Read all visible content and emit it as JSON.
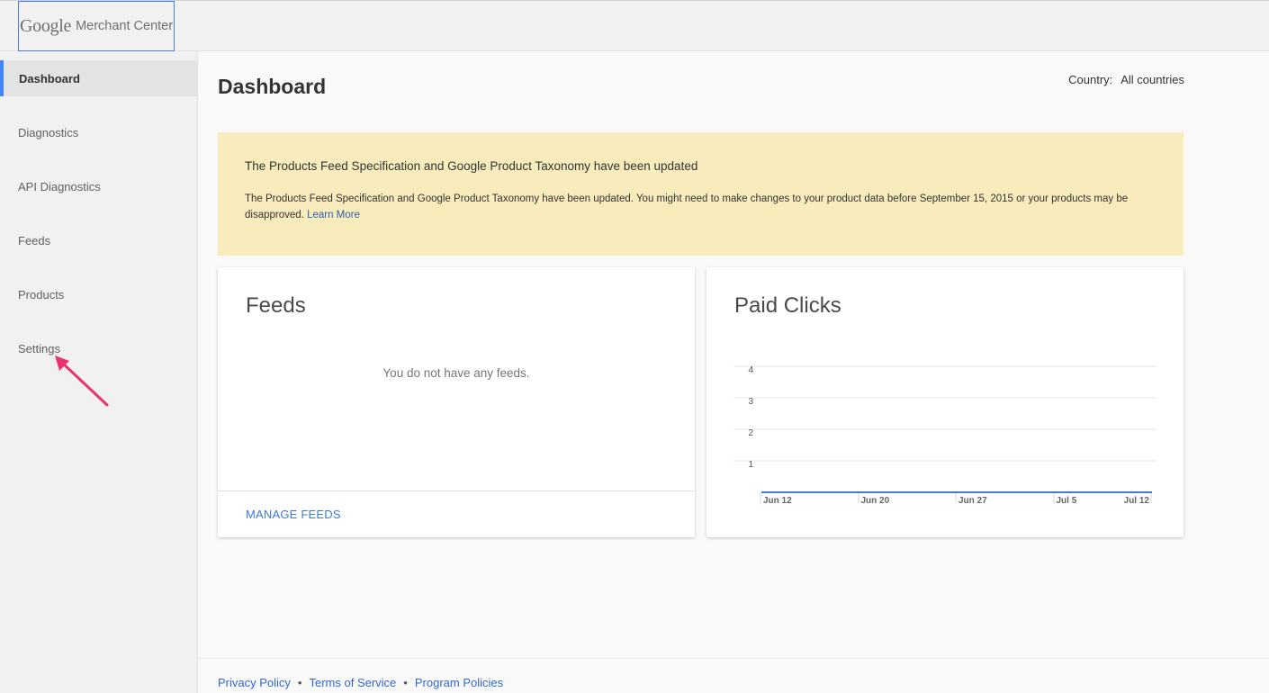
{
  "header": {
    "logo_google": "Google",
    "logo_product": "Merchant Center"
  },
  "sidebar": {
    "items": [
      {
        "label": "Dashboard",
        "active": true
      },
      {
        "label": "Diagnostics"
      },
      {
        "label": "API Diagnostics"
      },
      {
        "label": "Feeds"
      },
      {
        "label": "Products"
      },
      {
        "label": "Settings"
      }
    ]
  },
  "main": {
    "title": "Dashboard",
    "country_label": "Country:",
    "country_value": "All countries",
    "banner": {
      "title": "The Products Feed Specification and Google Product Taxonomy have been updated",
      "body": "The Products Feed Specification and Google Product Taxonomy have been updated. You might need to make changes to your product data before September 15, 2015 or your products may be disapproved.",
      "link": "Learn More"
    },
    "feeds_card": {
      "title": "Feeds",
      "empty_text": "You do not have any feeds.",
      "action": "MANAGE FEEDS"
    },
    "clicks_card": {
      "title": "Paid Clicks"
    }
  },
  "chart_data": {
    "type": "line",
    "title": "Paid Clicks",
    "x": [
      "Jun 12",
      "Jun 20",
      "Jun 27",
      "Jul 5",
      "Jul 12"
    ],
    "y_ticks": [
      1,
      2,
      3,
      4
    ],
    "ylim": [
      0,
      4
    ],
    "series": [
      {
        "values": [
          0,
          0,
          0,
          0,
          0
        ]
      }
    ],
    "grid": true,
    "colors": {
      "line": "#3f7fd8"
    }
  },
  "footer": {
    "links": [
      "Privacy Policy",
      "Terms of Service",
      "Program Policies"
    ],
    "separator": "•"
  },
  "colors": {
    "accent": "#4285f4",
    "banner": "#f8ebbc",
    "link": "#3367d6",
    "annotation_arrow": "#e8356d"
  }
}
